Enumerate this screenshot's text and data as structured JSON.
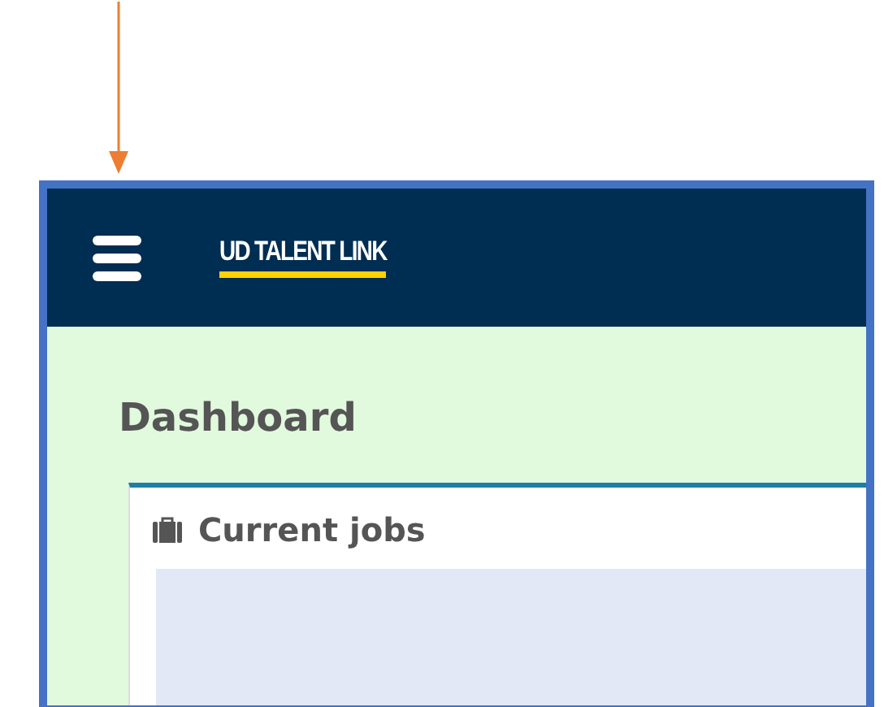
{
  "header": {
    "logo": "UD TALENT LINK"
  },
  "page": {
    "title": "Dashboard"
  },
  "card": {
    "title": "Current jobs"
  }
}
